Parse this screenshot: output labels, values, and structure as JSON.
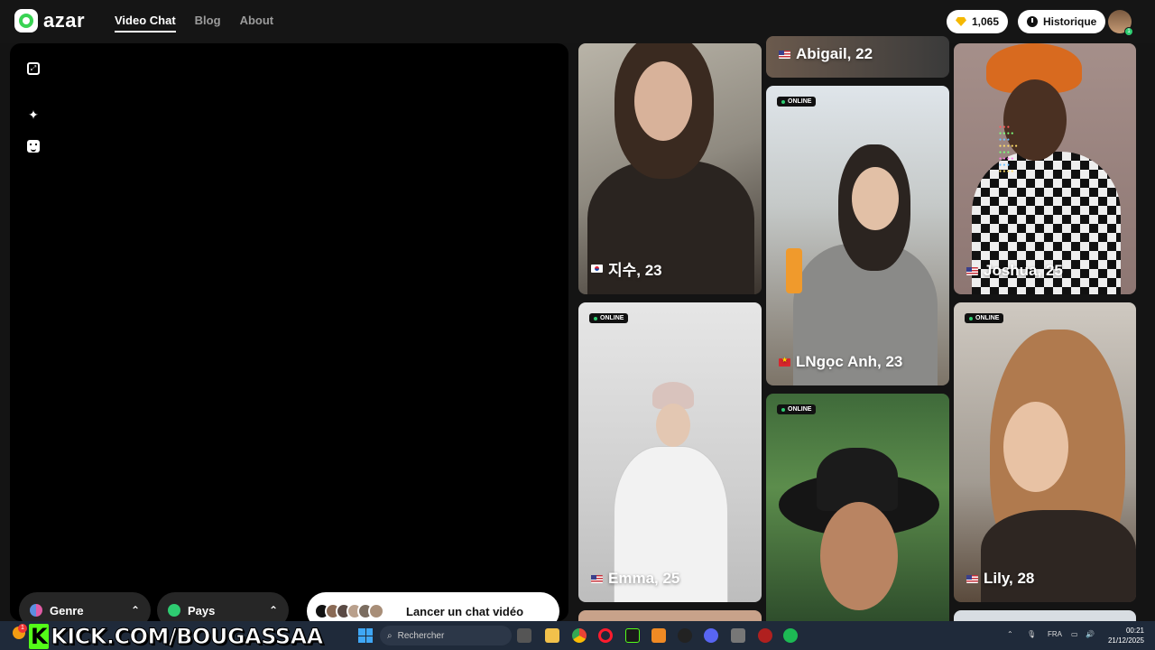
{
  "app": {
    "brand": "azar"
  },
  "nav": {
    "items": [
      {
        "label": "Video Chat",
        "active": true
      },
      {
        "label": "Blog",
        "active": false
      },
      {
        "label": "About",
        "active": false
      }
    ]
  },
  "header": {
    "gems": "1,065",
    "history_label": "Historique",
    "avatar_badge": "1"
  },
  "controls": {
    "gender_label": "Genre",
    "country_label": "Pays",
    "launch_label": "Lancer un chat vidéo"
  },
  "cards": {
    "c1": {
      "name": "지수, 23",
      "flag": "kr",
      "online": false
    },
    "c2": {
      "name": "Abigail, 22",
      "flag": "us",
      "online": false
    },
    "c3": {
      "name": "Joshua, 25",
      "flag": "us",
      "online": false
    },
    "c4": {
      "name": "LNgọc Anh, 23",
      "flag": "vn",
      "online": true
    },
    "c5": {
      "name": "Emma, 25",
      "flag": "us",
      "online": true
    },
    "c6": {
      "name": "Lily, 28",
      "flag": "us",
      "online": true
    },
    "c7": {
      "online": true
    },
    "online_label": "ONLINE"
  },
  "taskbar": {
    "stream_url": "KICK.COM/BOUGASSAA",
    "search_placeholder": "Rechercher",
    "language": "FRA",
    "time": "00:21",
    "date": "21/12/2025",
    "weather_badge": "1"
  },
  "colors": {
    "accent_green": "#39d353",
    "online_dot": "#2ecc71",
    "gem": "#f5b800"
  }
}
